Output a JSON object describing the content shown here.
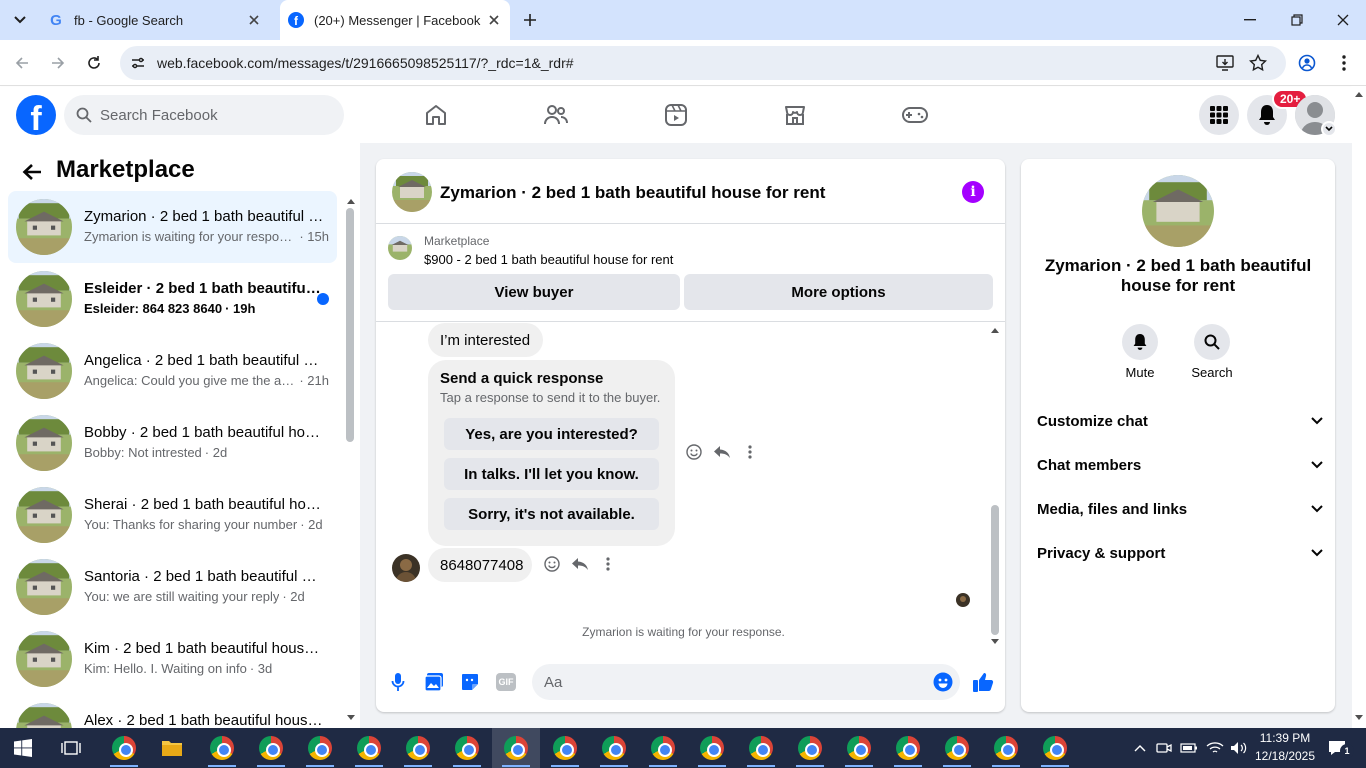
{
  "browser": {
    "tabs": [
      {
        "title": "fb - Google Search",
        "active": false
      },
      {
        "title": "(20+) Messenger | Facebook",
        "active": true
      }
    ],
    "url": "web.facebook.com/messages/t/2916665098525117/?_rdc=1&_rdr#"
  },
  "fb": {
    "search_placeholder": "Search Facebook",
    "notification_badge": "20+",
    "brand_color": "#0866ff"
  },
  "left": {
    "title": "Marketplace",
    "conversations": [
      {
        "name": "Zymarion · 2 bed 1 bath beautiful house for rent",
        "preview": "Zymarion is waiting for your response.",
        "time": "· 15h",
        "selected": true,
        "unread": false
      },
      {
        "name": "Esleider · 2 bed 1 bath beautiful house for rent",
        "preview": "Esleider: 864 823 8640",
        "time": "· 19h",
        "selected": false,
        "unread": true
      },
      {
        "name": "Angelica · 2 bed 1 bath beautiful house for rent",
        "preview": "Angelica: Could you give me the address",
        "time": "· 21h",
        "selected": false,
        "unread": false
      },
      {
        "name": "Bobby · 2 bed 1 bath beautiful house for rent",
        "preview": "Bobby: Not intrested",
        "time": "· 2d",
        "selected": false,
        "unread": false
      },
      {
        "name": "Sherai · 2 bed 1 bath beautiful house for rent",
        "preview": "You: Thanks for sharing your number",
        "time": "· 2d",
        "selected": false,
        "unread": false
      },
      {
        "name": "Santoria · 2 bed 1 bath beautiful house for rent",
        "preview": "You: we are still waiting your reply",
        "time": "· 2d",
        "selected": false,
        "unread": false
      },
      {
        "name": "Kim · 2 bed 1 bath beautiful house for rent",
        "preview": "Kim: Hello. I. Waiting on info",
        "time": "· 3d",
        "selected": false,
        "unread": false
      },
      {
        "name": "Alex · 2 bed 1 bath beautiful house for rent",
        "preview": "",
        "time": "",
        "selected": false,
        "unread": false
      }
    ]
  },
  "chat": {
    "title": "Zymarion · 2 bed 1 bath beautiful house for rent",
    "listing_label": "Marketplace",
    "listing_title": "$900 - 2 bed 1 bath beautiful house for rent",
    "view_buyer": "View buyer",
    "more_options": "More options",
    "msg_interested": "I’m interested",
    "quick_title": "Send a quick response",
    "quick_sub": "Tap a response to send it to the buyer.",
    "quick_replies": [
      "Yes, are you interested?",
      "In talks. I'll let you know.",
      "Sorry, it's not available."
    ],
    "msg_phone": "8648077408",
    "waiting_note": "Zymarion is waiting for your response.",
    "composer_placeholder": "Aa",
    "gif_label": "GIF"
  },
  "info": {
    "name": "Zymarion · 2 bed 1 bath beautiful house for rent",
    "mute_label": "Mute",
    "search_label": "Search",
    "sections": [
      "Customize chat",
      "Chat members",
      "Media, files and links",
      "Privacy & support"
    ]
  },
  "taskbar": {
    "time": "11:39 PM",
    "date": "12/18/2025",
    "notif_count": "1"
  }
}
